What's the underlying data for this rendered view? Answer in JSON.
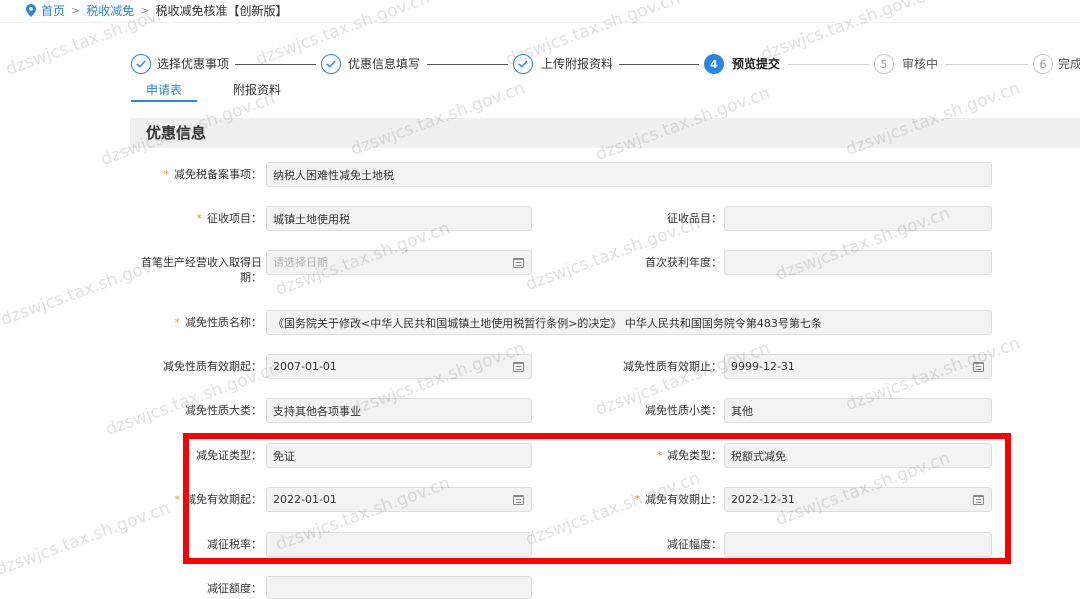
{
  "breadcrumb": {
    "items": [
      "首页",
      "税收减免",
      "税收减免核准【创新版】"
    ],
    "separator": ">"
  },
  "steps": [
    {
      "label": "选择优惠事项",
      "icon": "check-circle-icon"
    },
    {
      "label": "优惠信息填写",
      "icon": "check-circle-icon"
    },
    {
      "label": "上传附报资料",
      "icon": "check-circle-icon"
    },
    {
      "label": "预览提交",
      "number": "4",
      "current": true
    },
    {
      "label": "审核中",
      "number": "5"
    },
    {
      "label": "完成",
      "number": "6"
    }
  ],
  "tabs": [
    {
      "label": "申请表",
      "active": true
    },
    {
      "label": "附报资料",
      "active": false
    }
  ],
  "section": {
    "title": "优惠信息"
  },
  "form": {
    "required_mark": "*",
    "fields": {
      "filing_item": {
        "label": "减免税备案事项：",
        "required": true,
        "value": "纳税人困难性减免土地税"
      },
      "levy_item": {
        "label": "征收项目：",
        "required": true,
        "value": "城镇土地使用税"
      },
      "levy_subitem": {
        "label": "征收品目：",
        "required": false,
        "value": ""
      },
      "first_income_date": {
        "label": "首笔生产经营收入取得日期：",
        "required": false,
        "value": "",
        "placeholder": "请选择日期"
      },
      "first_profit_year": {
        "label": "首次获利年度：",
        "required": false,
        "value": ""
      },
      "relief_nature_name": {
        "label": "减免性质名称：",
        "required": true,
        "value": "《国务院关于修改<中华人民共和国城镇土地使用税暂行条例>的决定》 中华人民共和国国务院令第483号第七条"
      },
      "relief_nature_start": {
        "label": "减免性质有效期起：",
        "required": false,
        "value": "2007-01-01"
      },
      "relief_nature_end": {
        "label": "减免性质有效期止：",
        "required": false,
        "value": "9999-12-31"
      },
      "relief_nature_category": {
        "label": "减免性质大类：",
        "required": false,
        "value": "支持其他各项事业"
      },
      "relief_nature_subcategory": {
        "label": "减免性质小类：",
        "required": false,
        "value": "其他"
      },
      "certificate_type": {
        "label": "减免证类型：",
        "required": true,
        "value": "免证"
      },
      "relief_type": {
        "label": "减免类型：",
        "required": true,
        "value": "税额式减免"
      },
      "relief_start": {
        "label": "减免有效期起：",
        "required": true,
        "value": "2022-01-01"
      },
      "relief_end": {
        "label": "减免有效期止：",
        "required": true,
        "value": "2022-12-31"
      },
      "reduction_rate": {
        "label": "减征税率：",
        "required": false,
        "value": ""
      },
      "reduction_range": {
        "label": "减征幅度：",
        "required": false,
        "value": ""
      },
      "reduction_amount": {
        "label": "减征额度：",
        "required": false,
        "value": ""
      }
    }
  },
  "watermark": {
    "text": "dzswjcs.tax.sh.gov.cn"
  },
  "icons": {
    "breadcrumb": "location-pin-icon",
    "date_picker": "calendar-icon",
    "step_done": "check-circle-icon"
  },
  "colors": {
    "accent": "#2b85e4",
    "required_mark": "#f7941d",
    "highlight_box": "#ff0000",
    "input_background": "#f3f3f3",
    "section_background": "#f0f0f0"
  }
}
